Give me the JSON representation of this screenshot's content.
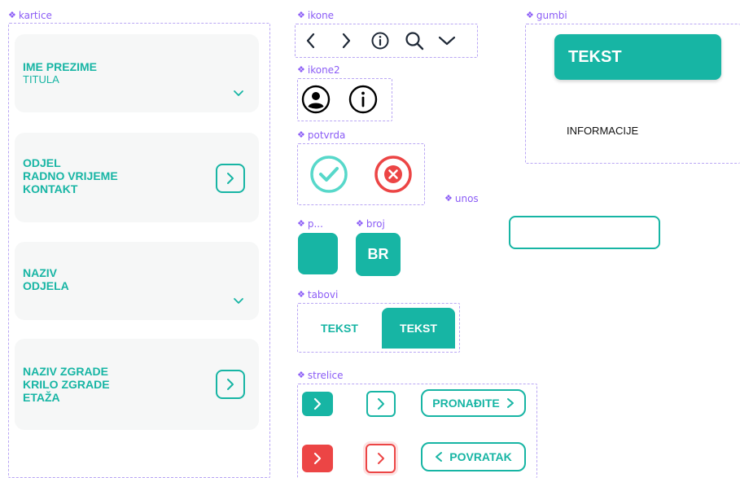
{
  "frames": {
    "kartice": "kartice",
    "ikone": "ikone",
    "ikone2": "ikone2",
    "potvrda": "potvrda",
    "p": "p...",
    "broj": "broj",
    "tabovi": "tabovi",
    "strelice": "strelice",
    "gumbi": "gumbi",
    "unos": "unos"
  },
  "cards": {
    "card1": {
      "title": "IME PREZIME",
      "subtitle": "TITULA"
    },
    "card2": {
      "line1": "ODJEL",
      "line2": "RADNO VRIJEME",
      "line3": "KONTAKT"
    },
    "card3": {
      "line1": "NAZIV",
      "line2": "ODJELA"
    },
    "card4": {
      "line1": "NAZIV ZGRADE",
      "line2": "KRILO ZGRADE",
      "line3": "ETAŽA"
    }
  },
  "broj": {
    "label": "BR"
  },
  "tabs": {
    "tab1": "TEKST",
    "tab2": "TEKST"
  },
  "strelice": {
    "find_label": "PRONAĐITE",
    "back_label": "POVRATAK"
  },
  "gumbi": {
    "button_label": "TEKST",
    "info_label": "INFORMACIJE"
  },
  "colors": {
    "teal": "#17b5a4",
    "red": "#ec4545",
    "purple": "#8b5cf6"
  }
}
